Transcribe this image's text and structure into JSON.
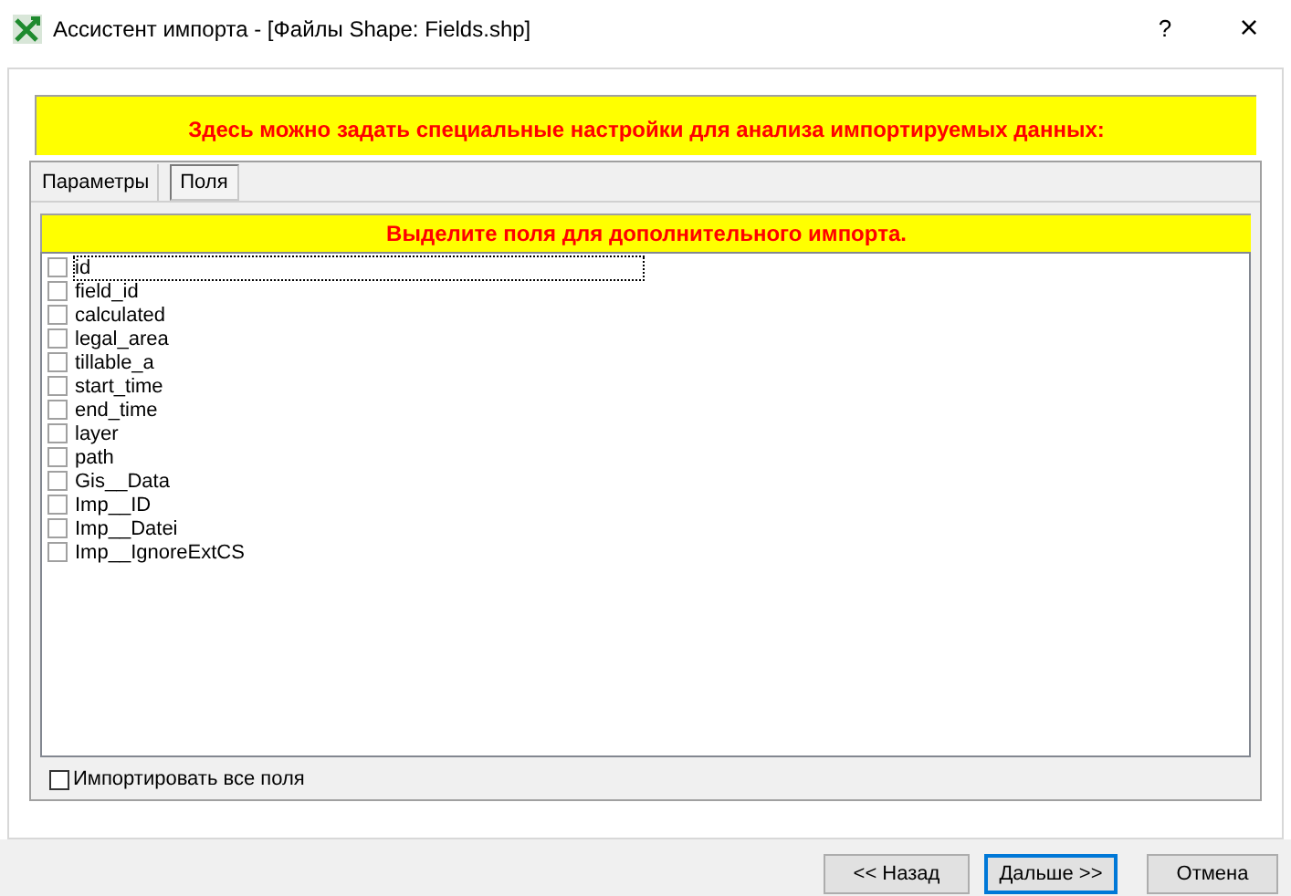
{
  "window": {
    "title": "Ассистент импорта - [Файлы Shape: Fields.shp]",
    "help": "?",
    "close": "×"
  },
  "banner": "Здесь можно задать специальные настройки для анализа импортируемых данных:",
  "tabs": [
    {
      "label": "Параметры",
      "selected": false
    },
    {
      "label": "Поля",
      "selected": true
    }
  ],
  "fields_header": "Выделите поля для дополнительного импорта.",
  "fields": [
    {
      "label": "id",
      "checked": false,
      "focused": true
    },
    {
      "label": "field_id",
      "checked": false,
      "focused": false
    },
    {
      "label": "calculated",
      "checked": false,
      "focused": false
    },
    {
      "label": "legal_area",
      "checked": false,
      "focused": false
    },
    {
      "label": "tillable_a",
      "checked": false,
      "focused": false
    },
    {
      "label": "start_time",
      "checked": false,
      "focused": false
    },
    {
      "label": "end_time",
      "checked": false,
      "focused": false
    },
    {
      "label": "layer",
      "checked": false,
      "focused": false
    },
    {
      "label": "path",
      "checked": false,
      "focused": false
    },
    {
      "label": "Gis__Data",
      "checked": false,
      "focused": false
    },
    {
      "label": "Imp__ID",
      "checked": false,
      "focused": false
    },
    {
      "label": "Imp__Datei",
      "checked": false,
      "focused": false
    },
    {
      "label": "Imp__IgnoreExtCS",
      "checked": false,
      "focused": false
    }
  ],
  "import_all": {
    "label": "Импортировать все поля",
    "checked": false
  },
  "buttons": [
    {
      "label": "<< Назад",
      "default": false
    },
    {
      "label": "Дальше >>",
      "default": true
    },
    {
      "label": "Отмена",
      "default": false
    }
  ]
}
